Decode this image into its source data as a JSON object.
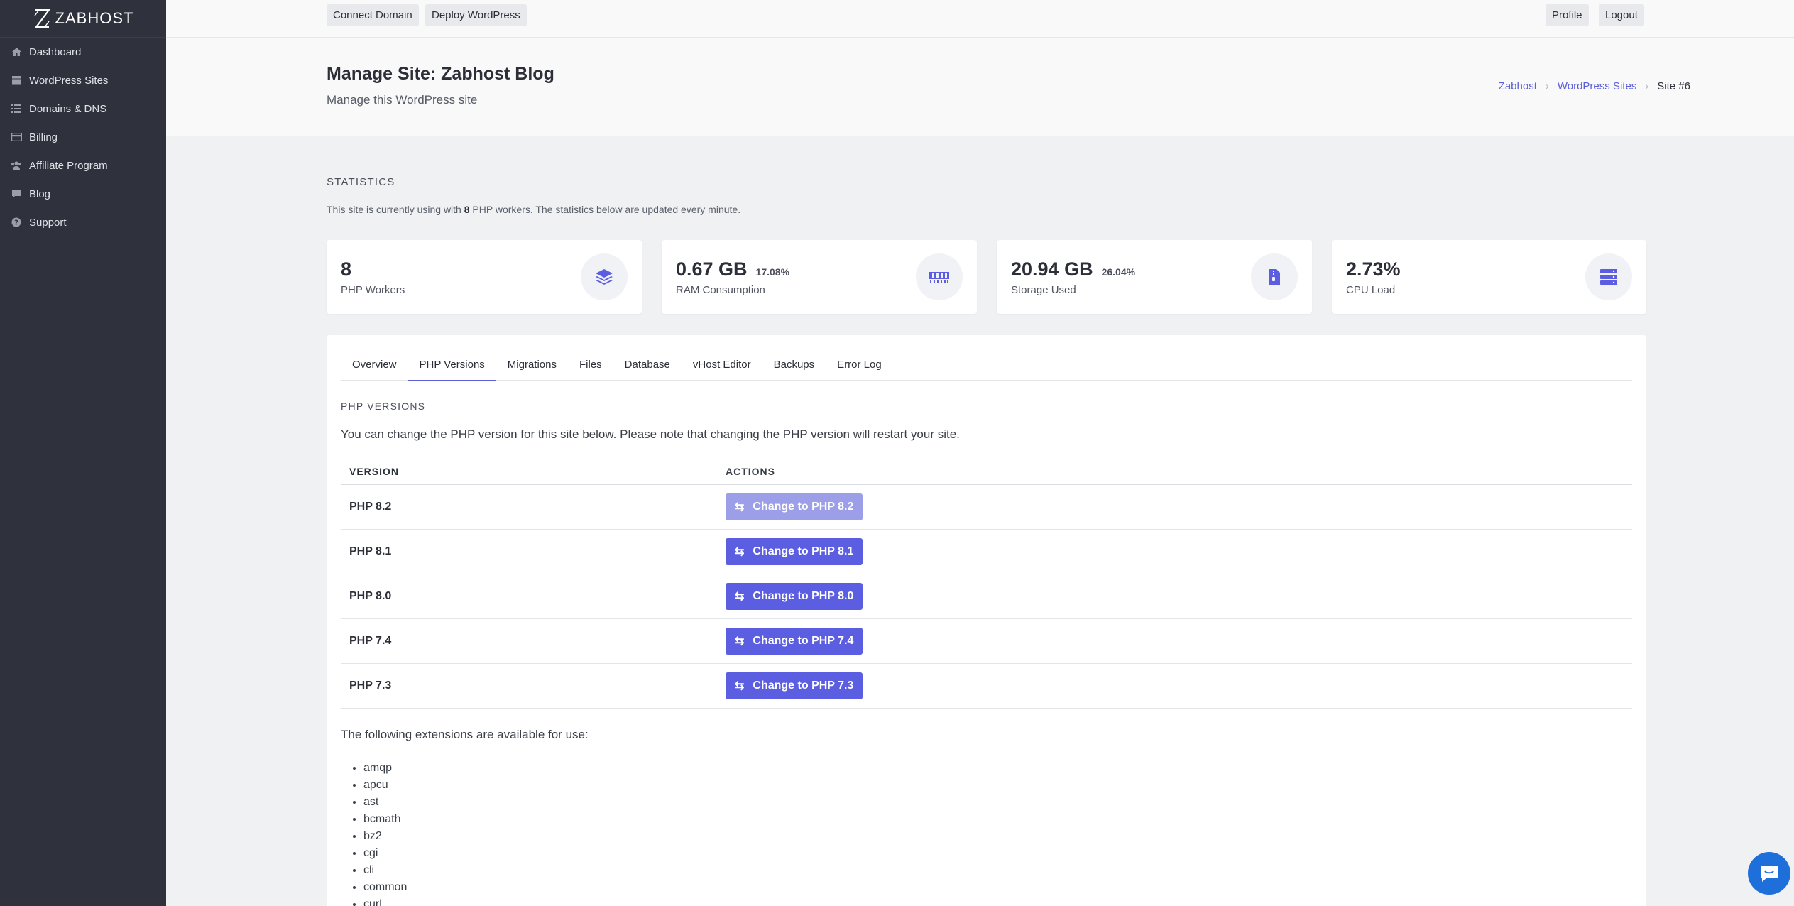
{
  "app": {
    "logo_text": "ZABHOST"
  },
  "sidebar": {
    "items": [
      {
        "label": "Dashboard",
        "icon": "home-icon"
      },
      {
        "label": "WordPress Sites",
        "icon": "server-icon"
      },
      {
        "label": "Domains & DNS",
        "icon": "list-icon"
      },
      {
        "label": "Billing",
        "icon": "credit-card-icon"
      },
      {
        "label": "Affiliate Program",
        "icon": "users-icon"
      },
      {
        "label": "Blog",
        "icon": "comment-icon"
      },
      {
        "label": "Support",
        "icon": "question-circle-icon"
      }
    ]
  },
  "topbar": {
    "connect_domain": "Connect Domain",
    "deploy_wordpress": "Deploy WordPress",
    "profile": "Profile",
    "logout": "Logout"
  },
  "header": {
    "title": "Manage Site: Zabhost Blog",
    "subtitle": "Manage this WordPress site",
    "breadcrumbs": [
      "Zabhost",
      "WordPress Sites",
      "Site #6"
    ]
  },
  "statistics": {
    "label": "STATISTICS",
    "desc_pre": "This site is currently using with ",
    "desc_count": "8",
    "desc_post": " PHP workers. The statistics below are updated every minute.",
    "cards": [
      {
        "value": "8",
        "pct": "",
        "label": "PHP Workers",
        "icon": "layers-icon"
      },
      {
        "value": "0.67 GB",
        "pct": "17.08%",
        "label": "RAM Consumption",
        "icon": "memory-icon"
      },
      {
        "value": "20.94 GB",
        "pct": "26.04%",
        "label": "Storage Used",
        "icon": "file-zip-icon"
      },
      {
        "value": "2.73%",
        "pct": "",
        "label": "CPU Load",
        "icon": "server-rack-icon"
      }
    ]
  },
  "tabs": [
    "Overview",
    "PHP Versions",
    "Migrations",
    "Files",
    "Database",
    "vHost Editor",
    "Backups",
    "Error Log"
  ],
  "active_tab": "PHP Versions",
  "php": {
    "label": "PHP VERSIONS",
    "desc": "You can change the PHP version for this site below. Please note that changing the PHP version will restart your site.",
    "col_version": "VERSION",
    "col_actions": "ACTIONS",
    "rows": [
      {
        "version": "PHP 8.2",
        "action": "Change to PHP 8.2",
        "disabled": true
      },
      {
        "version": "PHP 8.1",
        "action": "Change to PHP 8.1",
        "disabled": false
      },
      {
        "version": "PHP 8.0",
        "action": "Change to PHP 8.0",
        "disabled": false
      },
      {
        "version": "PHP 7.4",
        "action": "Change to PHP 7.4",
        "disabled": false
      },
      {
        "version": "PHP 7.3",
        "action": "Change to PHP 7.3",
        "disabled": false
      }
    ],
    "ext_intro": "The following extensions are available for use:",
    "extensions": [
      "amqp",
      "apcu",
      "ast",
      "bcmath",
      "bz2",
      "cgi",
      "cli",
      "common",
      "curl"
    ]
  },
  "colors": {
    "accent": "#5b5ee0",
    "sidebar_bg": "#2f323d",
    "chat": "#1e6fd9"
  }
}
